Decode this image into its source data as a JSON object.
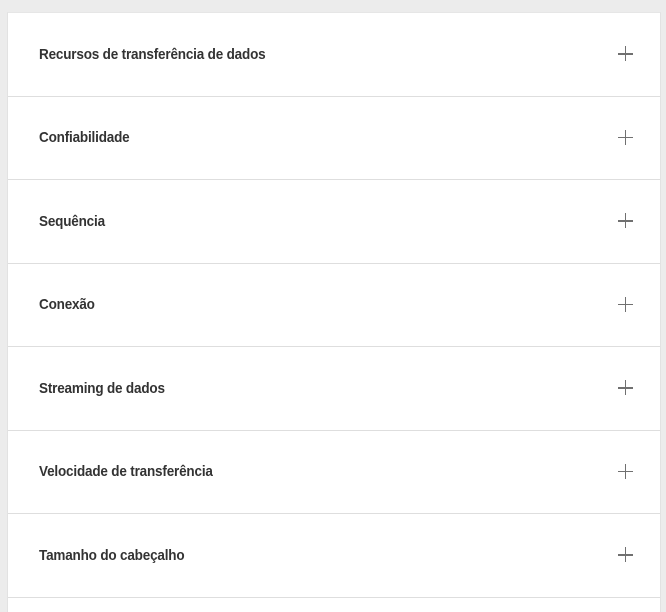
{
  "accordion": {
    "items": [
      {
        "label": "Recursos de transferência de dados",
        "icon": "plus-icon"
      },
      {
        "label": "Confiabilidade",
        "icon": "plus-icon"
      },
      {
        "label": "Sequência",
        "icon": "plus-icon"
      },
      {
        "label": "Conexão",
        "icon": "plus-icon"
      },
      {
        "label": "Streaming de dados",
        "icon": "plus-icon"
      },
      {
        "label": "Velocidade de transferência",
        "icon": "plus-icon"
      },
      {
        "label": "Tamanho do cabeçalho",
        "icon": "plus-icon"
      }
    ]
  }
}
